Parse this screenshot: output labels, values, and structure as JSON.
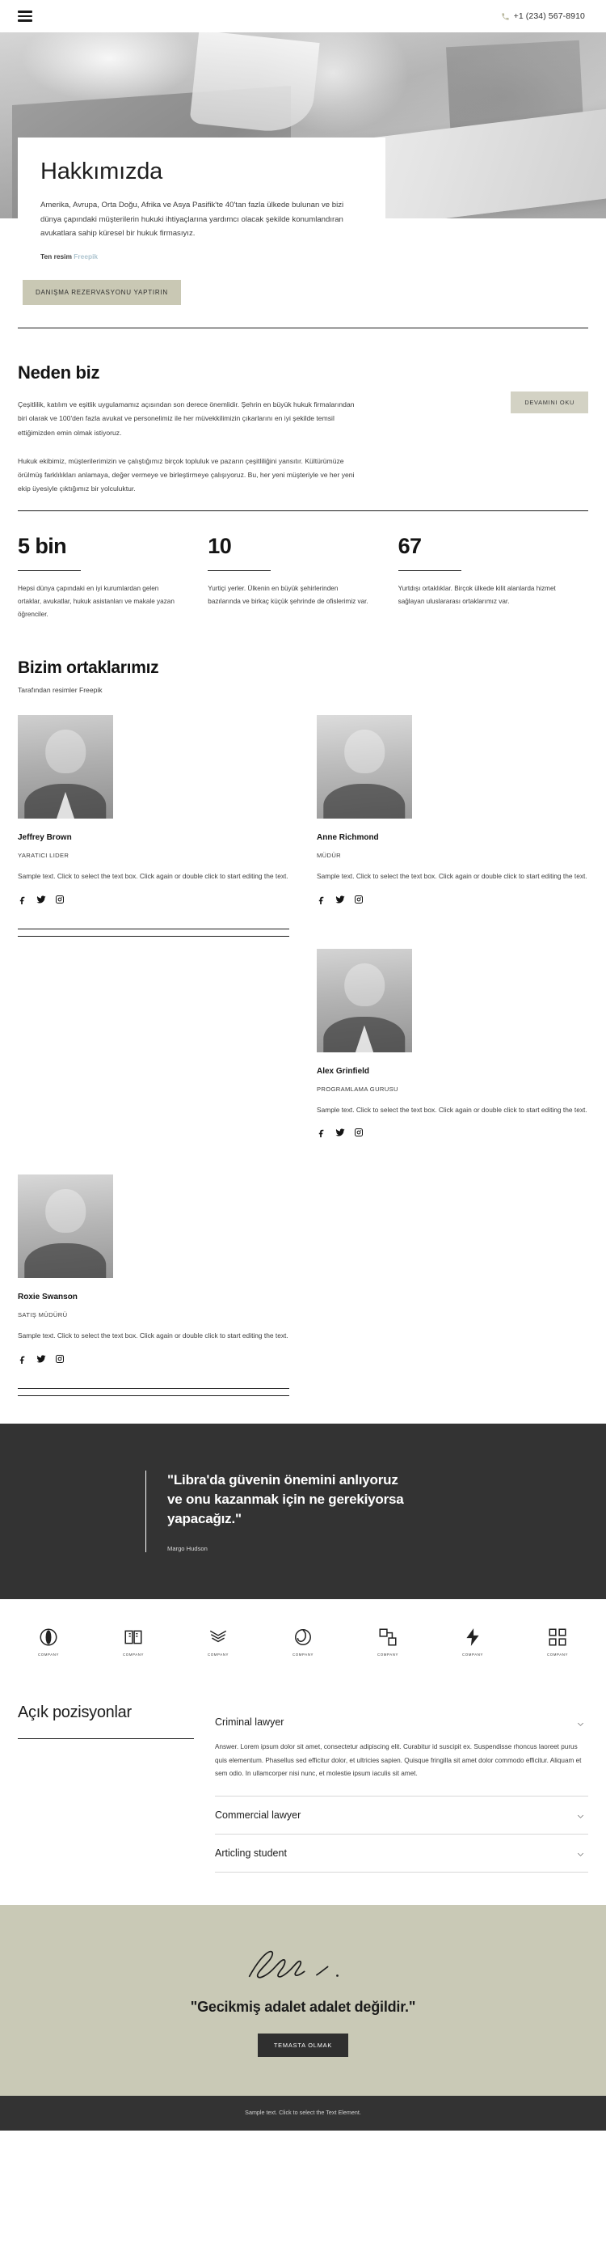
{
  "header": {
    "menu_icon": "hamburger-icon",
    "phone_icon": "phone-icon",
    "phone": "+1 (234) 567-8910"
  },
  "about": {
    "title": "Hakkımızda",
    "body": "Amerika, Avrupa, Orta Doğu, Afrika ve Asya Pasifik'te 40'tan fazla ülkede bulunan ve bizi dünya çapındaki müşterilerin hukuki ihtiyaçlarına yardımcı olacak şekilde konumlandıran avukatlara sahip küresel bir hukuk firmasıyız.",
    "credit_label": "Ten resim",
    "credit_link": "Freepik",
    "cta": "DANIŞMA REZERVASYONU YAPTIRIN"
  },
  "why": {
    "title": "Neden biz",
    "paragraph1": "Çeşitlilik, katılım ve eşitlik uygulamamız açısından son derece önemlidir. Şehrin en büyük hukuk firmalarından biri olarak ve 100'den fazla avukat ve personelimiz ile her müvekkilimizin çıkarlarını en iyi şekilde temsil ettiğimizden emin olmak istiyoruz.",
    "paragraph2": "Hukuk ekibimiz, müşterilerimizin ve çalıştığımız birçok topluluk ve pazarın çeşitliliğini yansıtır. Kültürümüze örülmüş farklılıkları anlamaya, değer vermeye ve birleştirmeye çalışıyoruz. Bu, her yeni müşteriyle ve her yeni ekip üyesiyle çıktığımız bir yolculuktur.",
    "read_more": "DEVAMINI OKU"
  },
  "stats": [
    {
      "number": "5 bin",
      "desc": "Hepsi dünya çapındaki en iyi kurumlardan gelen ortaklar, avukatlar, hukuk asistanları ve makale yazan öğrenciler."
    },
    {
      "number": "10",
      "desc": "Yurtiçi yerler. Ülkenin en büyük şehirlerinden bazılarında ve birkaç küçük şehrinde de ofislerimiz var."
    },
    {
      "number": "67",
      "desc": "Yurtdışı ortaklıklar. Birçok ülkede kilit alanlarda hizmet sağlayan uluslararası ortaklarımız var."
    }
  ],
  "partners": {
    "title": "Bizim ortaklarımız",
    "subtitle": "Tarafından resimler Freepik",
    "members": [
      {
        "name": "Jeffrey Brown",
        "role": "YARATICI LIDER",
        "bio": "Sample text. Click to select the text box. Click again or double click to start editing the text.",
        "socials": [
          "facebook-icon",
          "twitter-icon",
          "instagram-icon"
        ]
      },
      {
        "name": "Anne Richmond",
        "role": "MÜDÜR",
        "bio": "Sample text. Click to select the text box. Click again or double click to start editing the text.",
        "socials": [
          "facebook-icon",
          "twitter-icon",
          "instagram-icon"
        ]
      },
      {
        "name": "Alex Grinfield",
        "role": "PROGRAMLAMA GURUSU",
        "bio": "Sample text. Click to select the text box. Click again or double click to start editing the text.",
        "socials": [
          "facebook-icon",
          "twitter-icon",
          "instagram-icon"
        ]
      },
      {
        "name": "Roxie Swanson",
        "role": "SATIŞ MÜDÜRÜ",
        "bio": "Sample text. Click to select the text box. Click again or double click to start editing the text.",
        "socials": [
          "facebook-icon",
          "twitter-icon",
          "instagram-icon"
        ]
      }
    ]
  },
  "quote": {
    "text": "\"Libra'da güvenin önemini anlıyoruz ve onu kazanmak için ne gerekiyorsa yapacağız.\"",
    "author": "Margo Hudson"
  },
  "logos": [
    {
      "icon": "circle-mark-logo",
      "caption": "COMPANY"
    },
    {
      "icon": "book-mark-logo",
      "caption": "COMPANY"
    },
    {
      "icon": "chevron-stack-logo",
      "caption": "COMPANY"
    },
    {
      "icon": "swirl-mark-logo",
      "caption": "COMPANY"
    },
    {
      "icon": "squares-mark-logo",
      "caption": "COMPANY"
    },
    {
      "icon": "bolt-mark-logo",
      "caption": "COMPANY"
    },
    {
      "icon": "grid-mark-logo",
      "caption": "COMPANY"
    }
  ],
  "vacancies": {
    "title": "Açık pozisyonlar",
    "items": [
      {
        "title": "Criminal lawyer",
        "expanded": true,
        "body": "Answer. Lorem ipsum dolor sit amet, consectetur adipiscing elit. Curabitur id suscipit ex. Suspendisse rhoncus laoreet purus quis elementum. Phasellus sed efficitur dolor, et ultricies sapien. Quisque fringilla sit amet dolor commodo efficitur. Aliquam et sem odio. In ullamcorper nisi nunc, et molestie ipsum iaculis sit amet."
      },
      {
        "title": "Commercial lawyer",
        "expanded": false,
        "body": ""
      },
      {
        "title": "Articling student",
        "expanded": false,
        "body": ""
      }
    ],
    "chevron_icon": "chevron-down-icon"
  },
  "cta": {
    "signature_icon": "signature-mark",
    "title": "\"Gecikmiş adalet adalet değildir.\"",
    "button": "TEMASTA OLMAK"
  },
  "footer": {
    "text": "Sample text. Click to select the Text Element."
  },
  "colors": {
    "accent_beige": "#c9c8b4",
    "band_beige": "#c9c9b6",
    "dark": "#333333",
    "link_blue": "#adc4cf"
  }
}
